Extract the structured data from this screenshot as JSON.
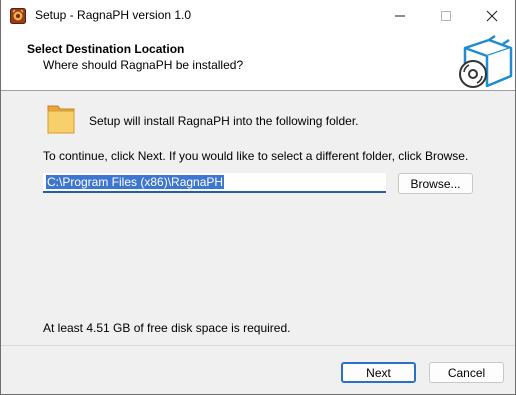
{
  "titlebar": {
    "title": "Setup - RagnaPH version 1.0",
    "app_icon": "installer-app-icon",
    "controls": {
      "minimize_icon": "minimize-icon",
      "maximize_icon": "maximize-icon",
      "close_icon": "close-icon"
    }
  },
  "header": {
    "title": "Select Destination Location",
    "subtitle": "Where should RagnaPH be installed?",
    "image": "setup-box-disc-icon"
  },
  "content": {
    "folder_icon": "folder-icon",
    "install_text": "Setup will install RagnaPH into the following folder.",
    "continue_text": "To continue, click Next. If you would like to select a different folder, click Browse.",
    "path_value": "C:\\Program Files (x86)\\RagnaPH",
    "browse_label": "Browse...",
    "disk_space_text": "At least 4.51 GB of free disk space is required."
  },
  "footer": {
    "next_label": "Next",
    "cancel_label": "Cancel"
  },
  "colors": {
    "accent": "#2a6fc9",
    "selection": "#3d76d1",
    "window_bg": "#f0f0f0",
    "header_bg": "#ffffff"
  }
}
